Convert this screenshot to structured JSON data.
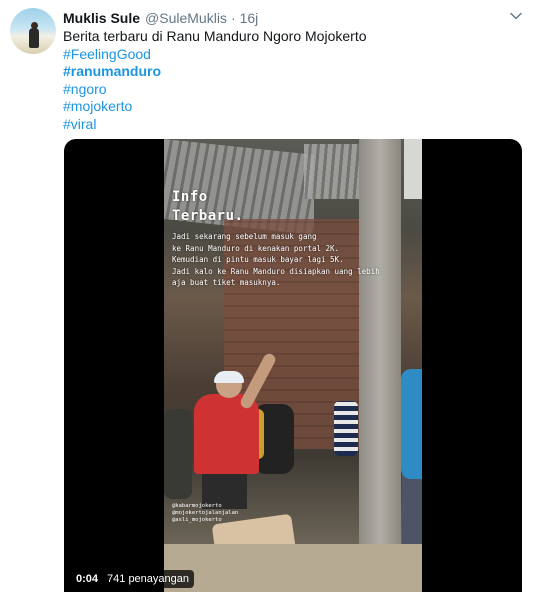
{
  "tweet": {
    "display_name": "Muklis Sule",
    "handle": "@SuleMuklis",
    "separator": "·",
    "time": "16j",
    "text": "Berita terbaru di Ranu Manduro Ngoro Mojokerto",
    "hashtags": [
      "#FeelingGood",
      "#ranumanduro",
      "#ngoro",
      "#mojokerto",
      "#viral"
    ]
  },
  "video": {
    "overlay_title": [
      "Info",
      "Terbaru."
    ],
    "overlay_text": [
      "Jadi sekarang sebelum masuk gang",
      "ke Ranu Manduro di kenakan portal 2K.",
      "Kemudian di pintu masuk bayar lagi 5K.",
      "Jadi kalo ke Ranu Manduro disiapkan uang lebih",
      "aja buat tiket masuknya."
    ],
    "credits": [
      "@kabarmojokerto",
      "@mojokertojalanjalan",
      "@asli_mojokerto"
    ],
    "elapsed": "0:04",
    "views": "741 penayangan"
  },
  "colors": {
    "link": "#1b95e0",
    "muted": "#657786",
    "text": "#14171a"
  },
  "icons": {
    "caret": "chevron-down-icon"
  }
}
